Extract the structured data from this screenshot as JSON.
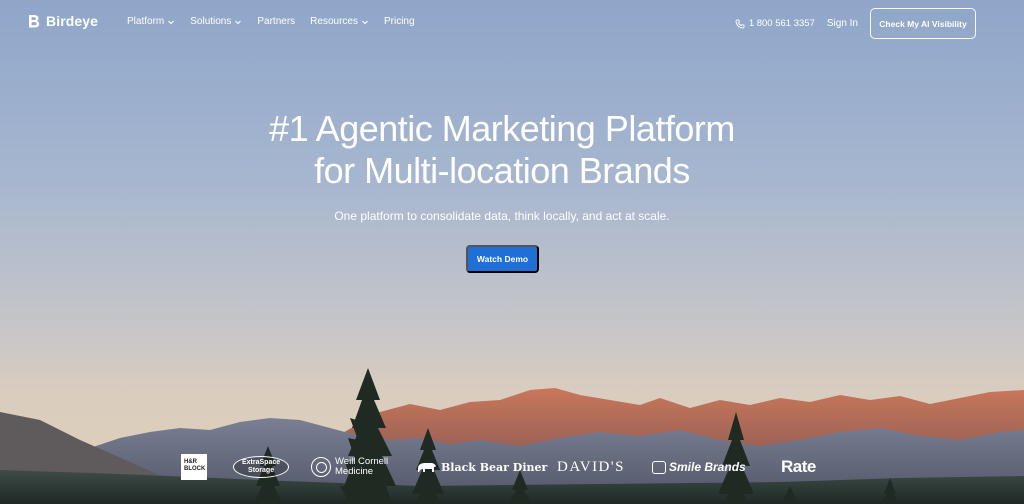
{
  "nav": {
    "logo": "Birdeye",
    "links": [
      {
        "label": "Platform",
        "dropdown": true
      },
      {
        "label": "Solutions",
        "dropdown": true
      },
      {
        "label": "Partners",
        "dropdown": false
      },
      {
        "label": "Resources",
        "dropdown": true
      },
      {
        "label": "Pricing",
        "dropdown": false
      }
    ],
    "phone": "1 800 561 3357",
    "sign_in": "Sign In",
    "cta": "Check My AI Visibility"
  },
  "hero": {
    "headline_line1": "#1 Agentic Marketing Platform",
    "headline_line2": "for Multi-location Brands",
    "subhead": "One platform to consolidate data, think locally, and act at scale.",
    "demo_button": "Watch Demo"
  },
  "logos": {
    "hr_block": "H&R BLOCK",
    "extraspace_line1": "ExtraSpace",
    "extraspace_line2": "Storage",
    "weill_line1": "Weill Cornell",
    "weill_line2": "Medicine",
    "black_bear": "Black Bear Diner",
    "davids": "DAVID'S",
    "smile": "Smile Brands",
    "rate": "Rate"
  },
  "colors": {
    "primary_button": "#1f6fd6",
    "sky_top": "#8fa6c9",
    "mountain_glow": "#c8714a"
  }
}
